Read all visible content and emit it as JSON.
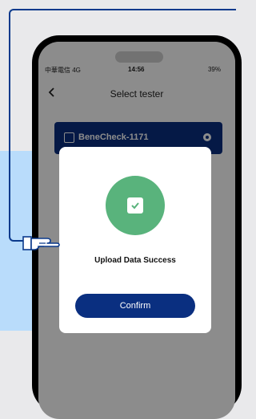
{
  "status_bar": {
    "carrier": "中華電信 4G",
    "time": "14:56",
    "battery": "39%"
  },
  "nav": {
    "title": "Select tester",
    "back_icon": "chevron-left-icon"
  },
  "tester": {
    "name": "BeneCheck-1171"
  },
  "modal": {
    "message": "Upload Data Success",
    "icon": "check-icon",
    "confirm_label": "Confirm"
  },
  "colors": {
    "brand": "#0a2f80",
    "success": "#59b37c",
    "guide": "#0b3a8c",
    "highlight": "#b9dcfb"
  }
}
